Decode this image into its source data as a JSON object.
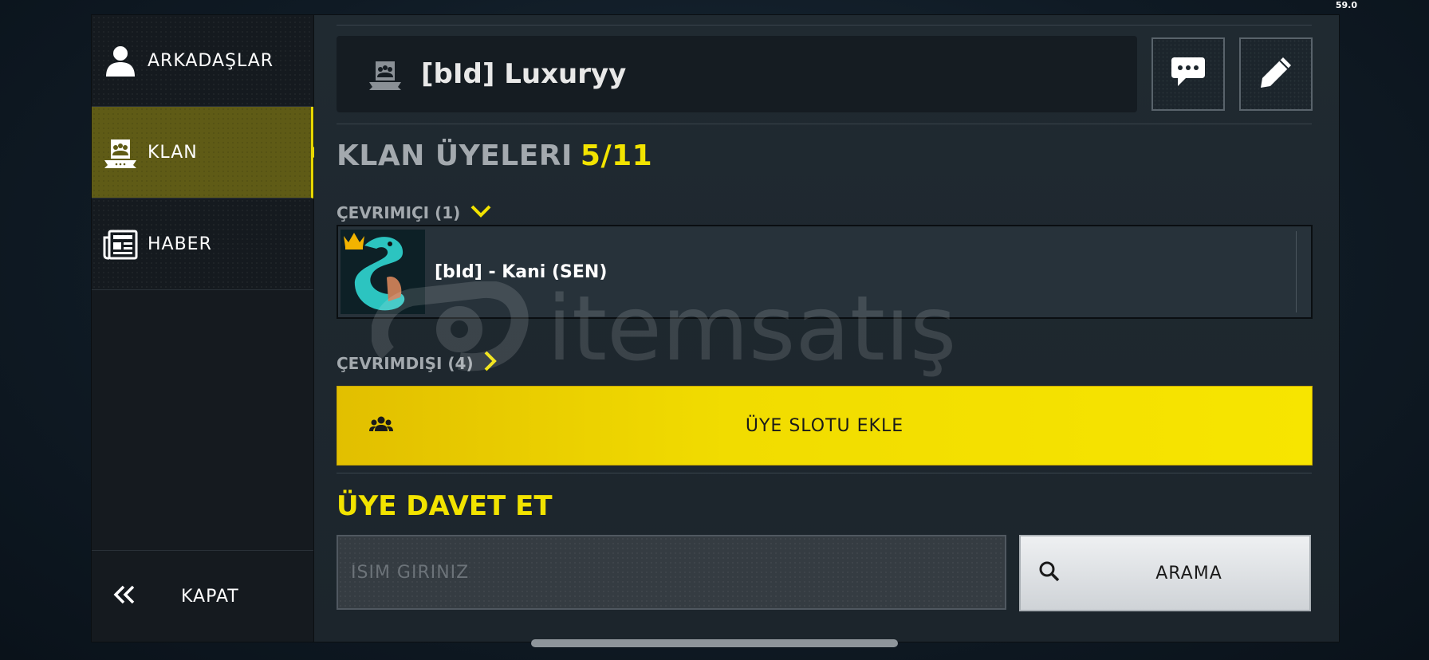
{
  "fps": "59.0",
  "sidebar": {
    "items": [
      {
        "label": "ARKADAŞLAR",
        "icon": "person-icon"
      },
      {
        "label": "KLAN",
        "icon": "clan-icon"
      },
      {
        "label": "HABER",
        "icon": "news-icon"
      }
    ],
    "close_label": "KAPAT"
  },
  "header": {
    "clan_name": "[bId] Luxuryy"
  },
  "members": {
    "title": "KLAN ÜYELERI",
    "count": "5/11",
    "online_label": "ÇEVRIMIÇI (1)",
    "offline_label": "ÇEVRIMDIŞI (4)",
    "online_members": [
      {
        "name": "[bId] - Kani (SEN)"
      }
    ],
    "add_slot_label": "ÜYE SLOTU EKLE"
  },
  "invite": {
    "title": "ÜYE DAVET ET",
    "placeholder": "İSIM GIRINIZ",
    "search_label": "ARAMA"
  },
  "watermark": "itemsatış",
  "colors": {
    "accent_yellow": "#f2e300",
    "panel_bg": "#1e272e",
    "sidebar_bg": "#151a1f",
    "active_item_bg": "#5f5b16"
  }
}
